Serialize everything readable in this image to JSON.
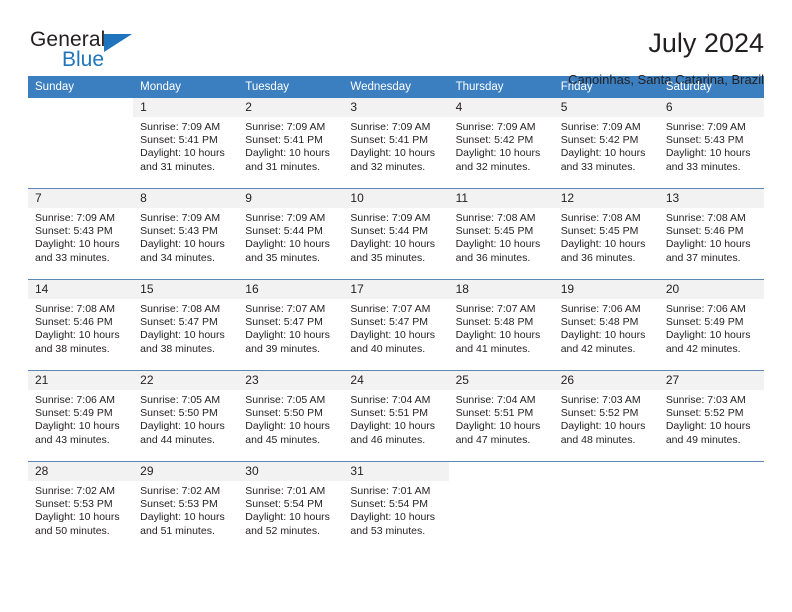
{
  "brand": {
    "name_dark": "General",
    "name_blue": "Blue",
    "accent_color": "#1f74bd"
  },
  "header": {
    "title": "July 2024",
    "subtitle": "Canoinhas, Santa Catarina, Brazil"
  },
  "calendar": {
    "header_bg": "#3c7fc0",
    "daynum_bg": "#f2f2f2",
    "weekday_labels": [
      "Sunday",
      "Monday",
      "Tuesday",
      "Wednesday",
      "Thursday",
      "Friday",
      "Saturday"
    ],
    "weeks": [
      [
        {
          "day": "",
          "sunrise": "",
          "sunset": "",
          "daylight": "",
          "blank": true
        },
        {
          "day": "1",
          "sunrise": "Sunrise: 7:09 AM",
          "sunset": "Sunset: 5:41 PM",
          "daylight": "Daylight: 10 hours and 31 minutes."
        },
        {
          "day": "2",
          "sunrise": "Sunrise: 7:09 AM",
          "sunset": "Sunset: 5:41 PM",
          "daylight": "Daylight: 10 hours and 31 minutes."
        },
        {
          "day": "3",
          "sunrise": "Sunrise: 7:09 AM",
          "sunset": "Sunset: 5:41 PM",
          "daylight": "Daylight: 10 hours and 32 minutes."
        },
        {
          "day": "4",
          "sunrise": "Sunrise: 7:09 AM",
          "sunset": "Sunset: 5:42 PM",
          "daylight": "Daylight: 10 hours and 32 minutes."
        },
        {
          "day": "5",
          "sunrise": "Sunrise: 7:09 AM",
          "sunset": "Sunset: 5:42 PM",
          "daylight": "Daylight: 10 hours and 33 minutes."
        },
        {
          "day": "6",
          "sunrise": "Sunrise: 7:09 AM",
          "sunset": "Sunset: 5:43 PM",
          "daylight": "Daylight: 10 hours and 33 minutes."
        }
      ],
      [
        {
          "day": "7",
          "sunrise": "Sunrise: 7:09 AM",
          "sunset": "Sunset: 5:43 PM",
          "daylight": "Daylight: 10 hours and 33 minutes."
        },
        {
          "day": "8",
          "sunrise": "Sunrise: 7:09 AM",
          "sunset": "Sunset: 5:43 PM",
          "daylight": "Daylight: 10 hours and 34 minutes."
        },
        {
          "day": "9",
          "sunrise": "Sunrise: 7:09 AM",
          "sunset": "Sunset: 5:44 PM",
          "daylight": "Daylight: 10 hours and 35 minutes."
        },
        {
          "day": "10",
          "sunrise": "Sunrise: 7:09 AM",
          "sunset": "Sunset: 5:44 PM",
          "daylight": "Daylight: 10 hours and 35 minutes."
        },
        {
          "day": "11",
          "sunrise": "Sunrise: 7:08 AM",
          "sunset": "Sunset: 5:45 PM",
          "daylight": "Daylight: 10 hours and 36 minutes."
        },
        {
          "day": "12",
          "sunrise": "Sunrise: 7:08 AM",
          "sunset": "Sunset: 5:45 PM",
          "daylight": "Daylight: 10 hours and 36 minutes."
        },
        {
          "day": "13",
          "sunrise": "Sunrise: 7:08 AM",
          "sunset": "Sunset: 5:46 PM",
          "daylight": "Daylight: 10 hours and 37 minutes."
        }
      ],
      [
        {
          "day": "14",
          "sunrise": "Sunrise: 7:08 AM",
          "sunset": "Sunset: 5:46 PM",
          "daylight": "Daylight: 10 hours and 38 minutes."
        },
        {
          "day": "15",
          "sunrise": "Sunrise: 7:08 AM",
          "sunset": "Sunset: 5:47 PM",
          "daylight": "Daylight: 10 hours and 38 minutes."
        },
        {
          "day": "16",
          "sunrise": "Sunrise: 7:07 AM",
          "sunset": "Sunset: 5:47 PM",
          "daylight": "Daylight: 10 hours and 39 minutes."
        },
        {
          "day": "17",
          "sunrise": "Sunrise: 7:07 AM",
          "sunset": "Sunset: 5:47 PM",
          "daylight": "Daylight: 10 hours and 40 minutes."
        },
        {
          "day": "18",
          "sunrise": "Sunrise: 7:07 AM",
          "sunset": "Sunset: 5:48 PM",
          "daylight": "Daylight: 10 hours and 41 minutes."
        },
        {
          "day": "19",
          "sunrise": "Sunrise: 7:06 AM",
          "sunset": "Sunset: 5:48 PM",
          "daylight": "Daylight: 10 hours and 42 minutes."
        },
        {
          "day": "20",
          "sunrise": "Sunrise: 7:06 AM",
          "sunset": "Sunset: 5:49 PM",
          "daylight": "Daylight: 10 hours and 42 minutes."
        }
      ],
      [
        {
          "day": "21",
          "sunrise": "Sunrise: 7:06 AM",
          "sunset": "Sunset: 5:49 PM",
          "daylight": "Daylight: 10 hours and 43 minutes."
        },
        {
          "day": "22",
          "sunrise": "Sunrise: 7:05 AM",
          "sunset": "Sunset: 5:50 PM",
          "daylight": "Daylight: 10 hours and 44 minutes."
        },
        {
          "day": "23",
          "sunrise": "Sunrise: 7:05 AM",
          "sunset": "Sunset: 5:50 PM",
          "daylight": "Daylight: 10 hours and 45 minutes."
        },
        {
          "day": "24",
          "sunrise": "Sunrise: 7:04 AM",
          "sunset": "Sunset: 5:51 PM",
          "daylight": "Daylight: 10 hours and 46 minutes."
        },
        {
          "day": "25",
          "sunrise": "Sunrise: 7:04 AM",
          "sunset": "Sunset: 5:51 PM",
          "daylight": "Daylight: 10 hours and 47 minutes."
        },
        {
          "day": "26",
          "sunrise": "Sunrise: 7:03 AM",
          "sunset": "Sunset: 5:52 PM",
          "daylight": "Daylight: 10 hours and 48 minutes."
        },
        {
          "day": "27",
          "sunrise": "Sunrise: 7:03 AM",
          "sunset": "Sunset: 5:52 PM",
          "daylight": "Daylight: 10 hours and 49 minutes."
        }
      ],
      [
        {
          "day": "28",
          "sunrise": "Sunrise: 7:02 AM",
          "sunset": "Sunset: 5:53 PM",
          "daylight": "Daylight: 10 hours and 50 minutes."
        },
        {
          "day": "29",
          "sunrise": "Sunrise: 7:02 AM",
          "sunset": "Sunset: 5:53 PM",
          "daylight": "Daylight: 10 hours and 51 minutes."
        },
        {
          "day": "30",
          "sunrise": "Sunrise: 7:01 AM",
          "sunset": "Sunset: 5:54 PM",
          "daylight": "Daylight: 10 hours and 52 minutes."
        },
        {
          "day": "31",
          "sunrise": "Sunrise: 7:01 AM",
          "sunset": "Sunset: 5:54 PM",
          "daylight": "Daylight: 10 hours and 53 minutes."
        },
        {
          "day": "",
          "sunrise": "",
          "sunset": "",
          "daylight": "",
          "blank": true
        },
        {
          "day": "",
          "sunrise": "",
          "sunset": "",
          "daylight": "",
          "blank": true
        },
        {
          "day": "",
          "sunrise": "",
          "sunset": "",
          "daylight": "",
          "blank": true
        }
      ]
    ]
  }
}
